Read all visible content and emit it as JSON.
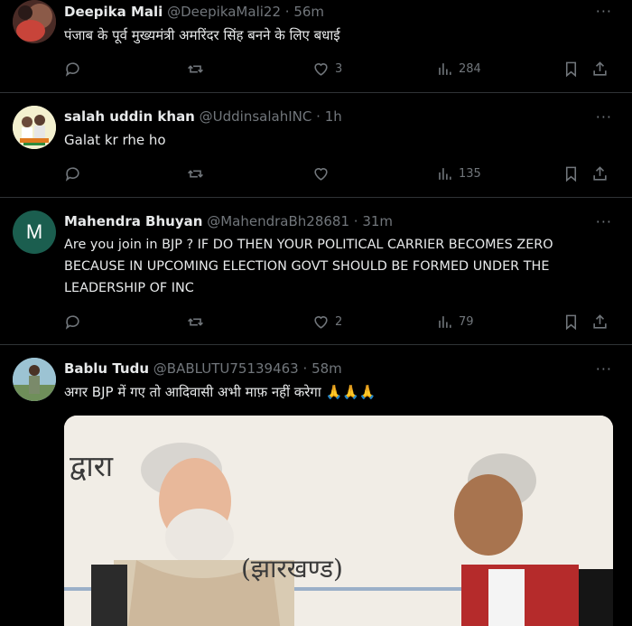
{
  "tweets": [
    {
      "name": "Deepika Mali",
      "handle": "@DeepikaMali22",
      "time": "56m",
      "text": "पंजाब के पूर्व मुख्यमंत्री अमरिंदर सिंह बनने के लिए बधाई",
      "replies": "",
      "retweets": "",
      "likes": "3",
      "views": "284"
    },
    {
      "name": "salah uddin khan",
      "handle": "@UddinsalahINC",
      "time": "1h",
      "text": "Galat kr rhe ho",
      "replies": "",
      "retweets": "",
      "likes": "",
      "views": "135"
    },
    {
      "name": "Mahendra Bhuyan",
      "handle": "@MahendraBh28681",
      "time": "31m",
      "avatar_letter": "M",
      "text": "Are you join in BJP ? IF DO THEN YOUR POLITICAL CARRIER BECOMES ZERO BECAUSE IN UPCOMING ELECTION GOVT SHOULD BE FORMED UNDER THE LEADERSHIP OF INC",
      "replies": "",
      "retweets": "",
      "likes": "2",
      "views": "79"
    },
    {
      "name": "Bablu Tudu",
      "handle": "@BABLUTU75139463",
      "time": "58m",
      "text": "अगर BJP में गए तो आदिवासी अभी माफ़ नहीं करेगा 🙏🙏🙏",
      "media_text_1": "द्वारा",
      "media_text_2": "(झारखण्ड)"
    }
  ],
  "separator": "·",
  "more_glyph": "···",
  "colors": {
    "background": "#000000",
    "text": "#e7e9ea",
    "secondary": "#71767b",
    "border": "#2f3336",
    "avatar_m": "#1b5e4f"
  }
}
